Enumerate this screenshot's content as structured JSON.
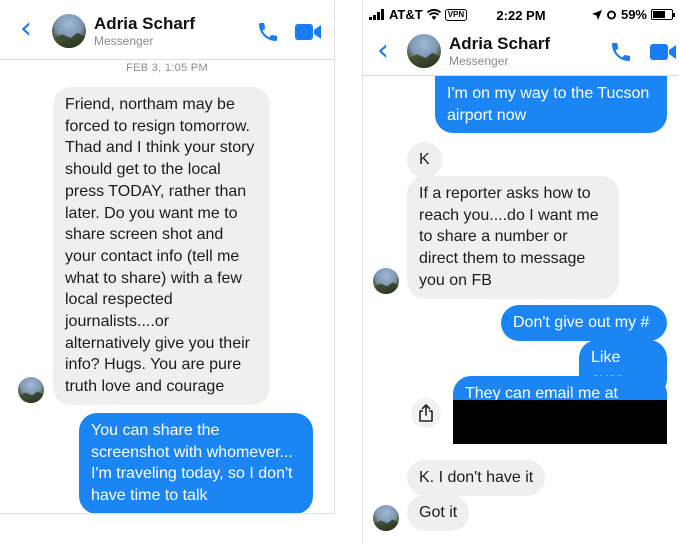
{
  "contact": {
    "name": "Adria Scharf",
    "subtitle": "Messenger"
  },
  "status_bar": {
    "carrier": "AT&T",
    "vpn": "VPN",
    "time": "2:22 PM",
    "battery": "59%"
  },
  "left": {
    "timestamp": "FEB 3, 1:05 PM",
    "messages": [
      {
        "dir": "in",
        "text": "Friend, northam may be forced to resign tomorrow. Thad and I think your story should get to the local press TODAY, rather than later. Do you want me to share screen shot and your contact info (tell me what to share) with a few local respected journalists....or alternatively give you their info? Hugs. You are pure truth love and courage"
      },
      {
        "dir": "out",
        "text": "You can share the screenshot with whomever... I'm traveling today, so I don't have time to talk"
      }
    ]
  },
  "right": {
    "messages": [
      {
        "dir": "out",
        "text": "I'm on my way to the Tucson airport now"
      },
      {
        "dir": "in",
        "text": "K"
      },
      {
        "dir": "in",
        "text": "If a reporter asks how to reach you....do I want me to share a number or direct them to message you on FB"
      },
      {
        "dir": "out",
        "text": "Don't give out my #"
      },
      {
        "dir": "out",
        "text": "Like ever"
      },
      {
        "dir": "out",
        "text": "They can email me at"
      },
      {
        "dir": "in",
        "text": "K. I don't have it"
      },
      {
        "dir": "in",
        "text": "Got it"
      }
    ]
  },
  "colors": {
    "accent": "#1a7cf4",
    "outgoing_bubble": "#1b86f3",
    "incoming_bubble": "#efefef"
  },
  "icons": [
    "back-chevron-icon",
    "phone-icon",
    "video-camera-icon",
    "share-icon",
    "signal-icon",
    "wifi-icon",
    "location-arrow-icon",
    "alarm-icon",
    "battery-icon"
  ]
}
